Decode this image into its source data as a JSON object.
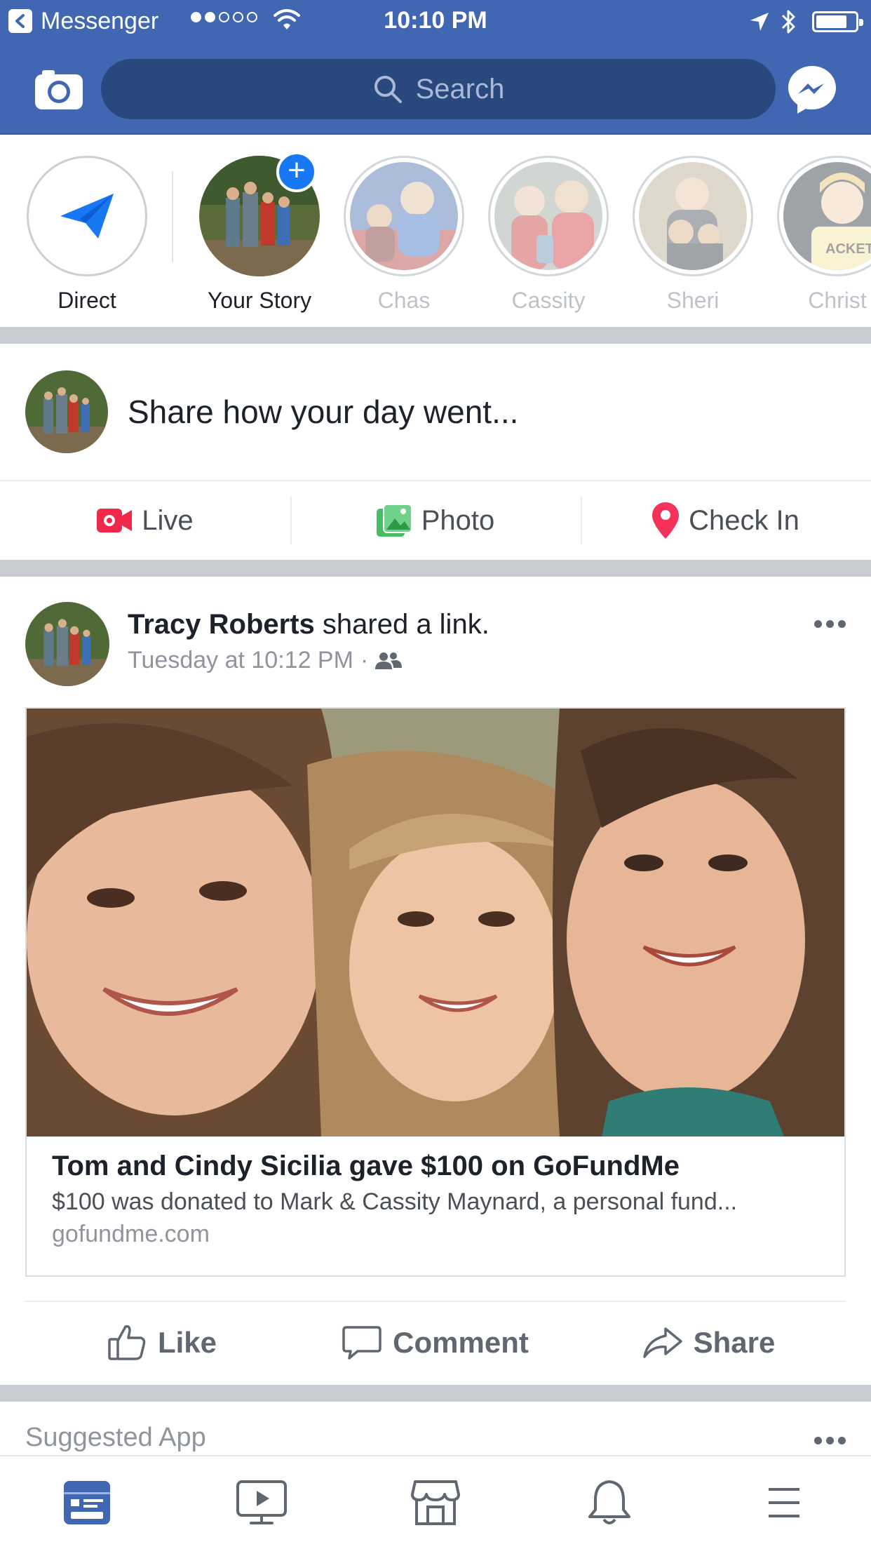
{
  "status_bar": {
    "back_app": "Messenger",
    "time": "10:10 PM",
    "signal_bars_filled": 2,
    "signal_bars_total": 5,
    "battery_level": 0.8
  },
  "header": {
    "search_placeholder": "Search",
    "camera_icon": "camera-icon",
    "messenger_icon": "messenger-icon",
    "brand_color": "#4267b2"
  },
  "stories": {
    "direct_label": "Direct",
    "your_story_label": "Your Story",
    "friends": [
      {
        "name": "Chas"
      },
      {
        "name": "Cassity"
      },
      {
        "name": "Sheri"
      },
      {
        "name": "Christ"
      }
    ]
  },
  "composer": {
    "prompt": "Share how your day went...",
    "actions": [
      {
        "label": "Live",
        "icon": "live-video-icon",
        "color": "#f02849"
      },
      {
        "label": "Photo",
        "icon": "photo-icon",
        "color": "#45bd62"
      },
      {
        "label": "Check In",
        "icon": "location-pin-icon",
        "color": "#f5533d"
      }
    ]
  },
  "post": {
    "author": "Tracy Roberts",
    "action": " shared a link.",
    "timestamp": "Tuesday at 10:12 PM",
    "audience_icon": "friends-icon",
    "link": {
      "title": "Tom and Cindy Sicilia gave $100 on GoFundMe",
      "description": "$100 was donated to Mark & Cassity Maynard, a personal fund...",
      "domain": "gofundme.com"
    },
    "buttons": {
      "like": "Like",
      "comment": "Comment",
      "share": "Share"
    }
  },
  "suggested": {
    "label": "Suggested App"
  },
  "tabbar": {
    "active_tab": "news-feed",
    "active_color": "#4267b2",
    "tabs": [
      "news-feed-icon",
      "watch-icon",
      "marketplace-icon",
      "notifications-icon",
      "menu-icon"
    ]
  }
}
